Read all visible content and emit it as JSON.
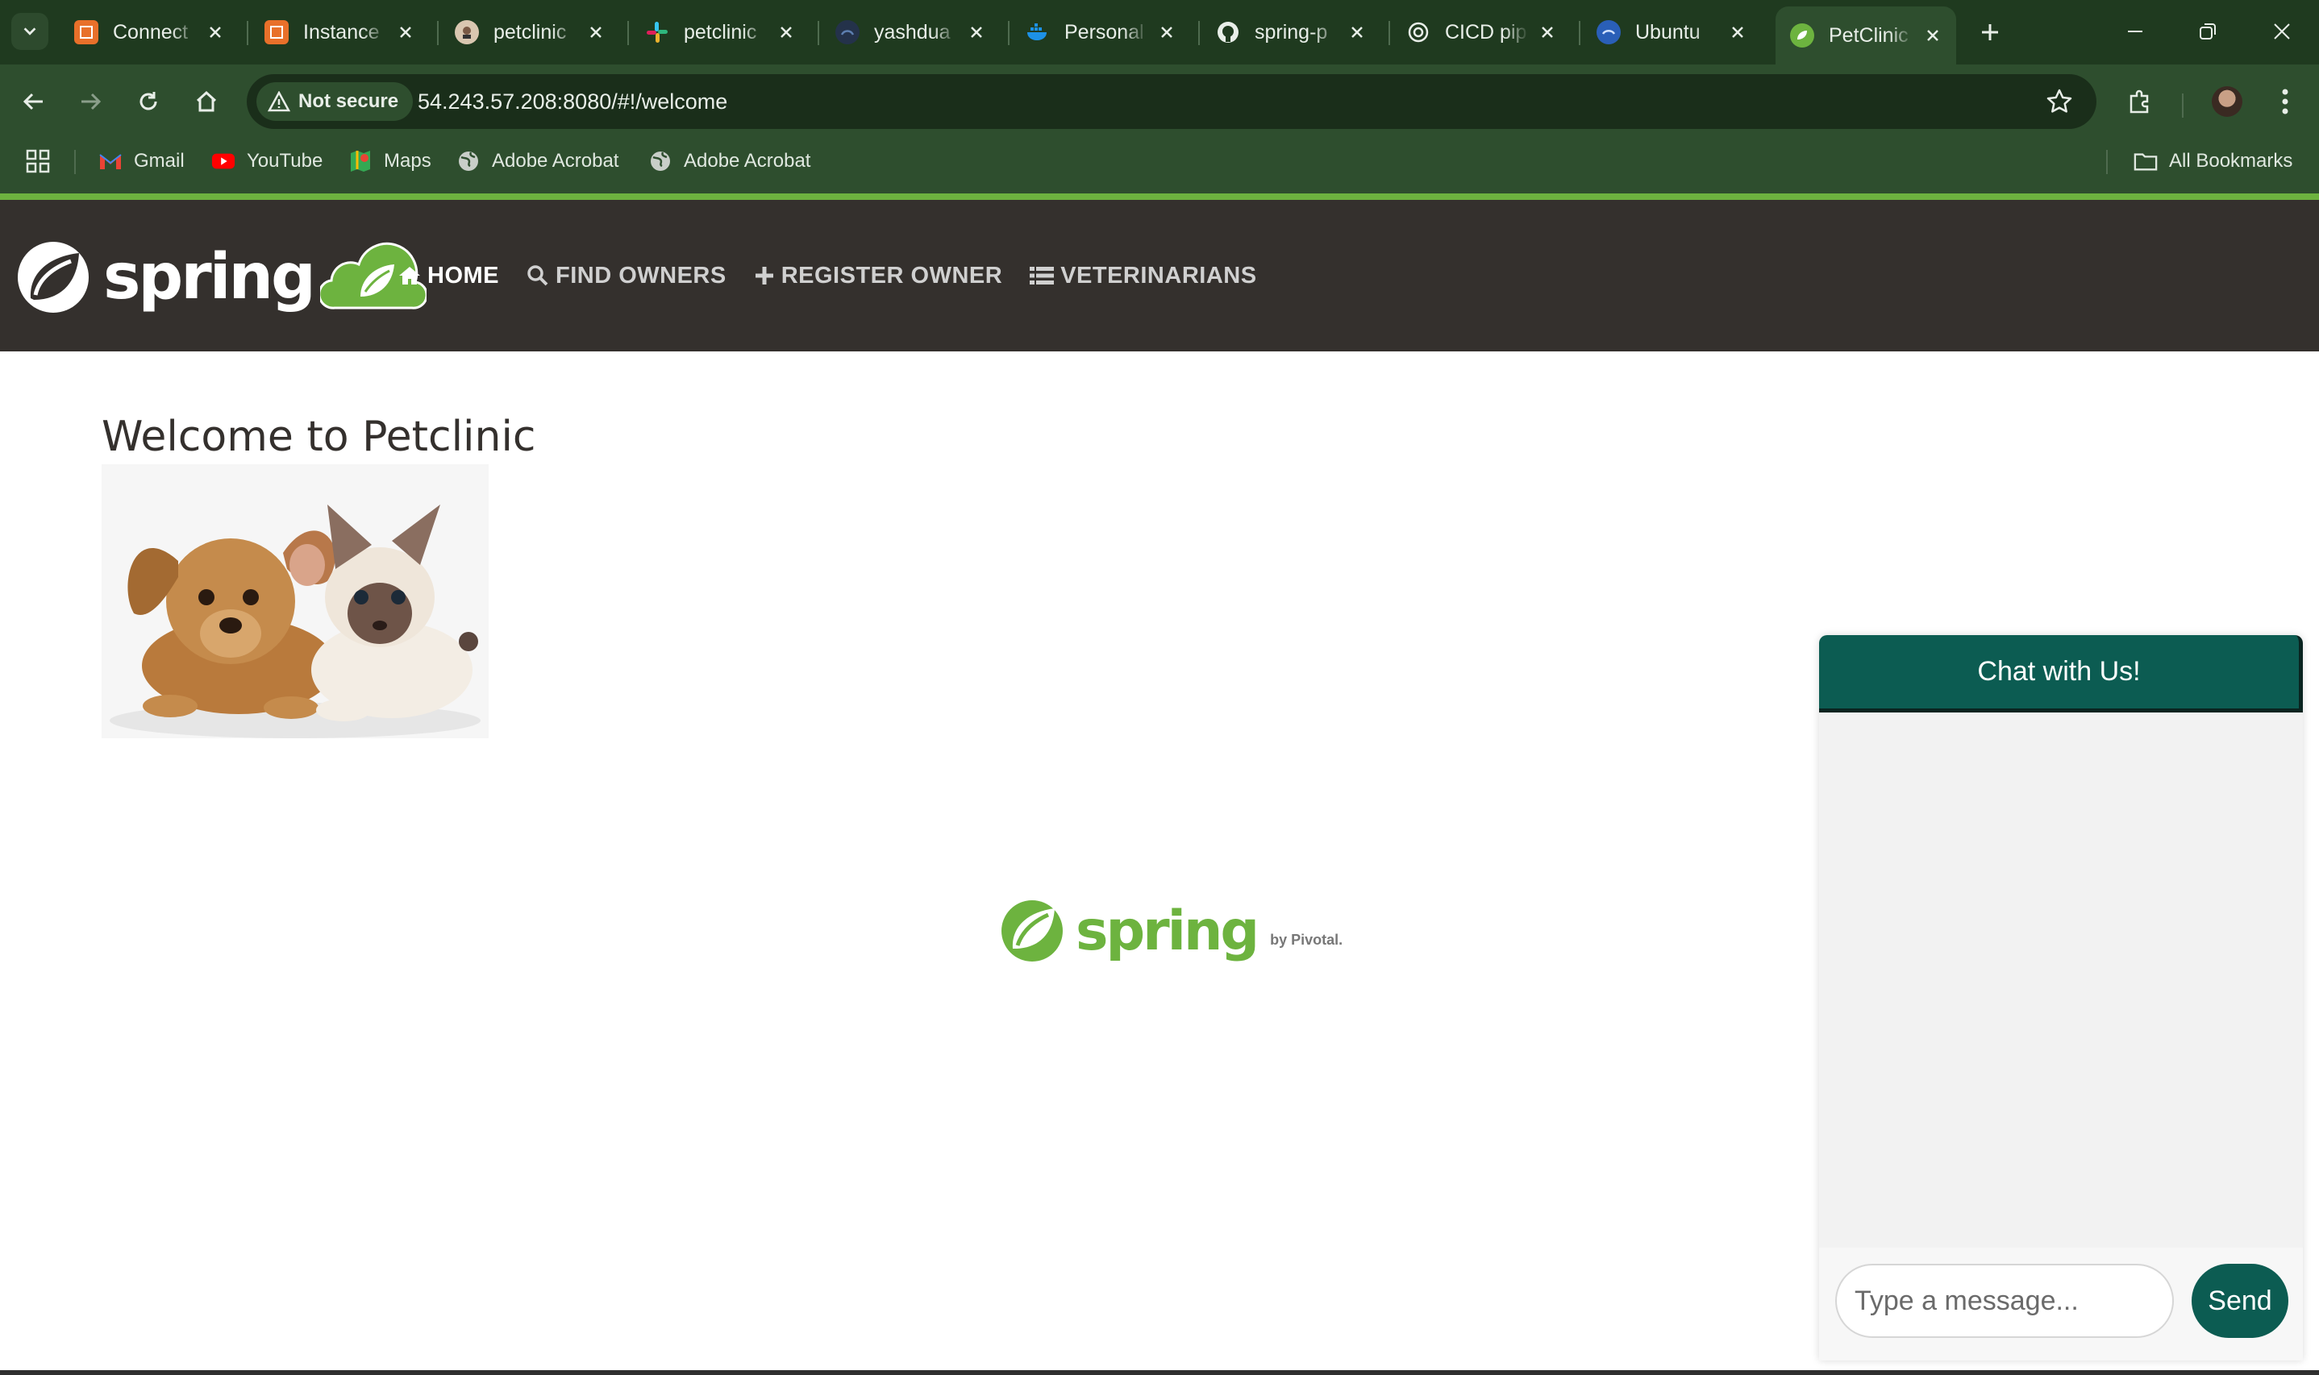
{
  "browser": {
    "tabs": [
      {
        "title": "Connect",
        "icon": "aws-icon",
        "active": false
      },
      {
        "title": "Instance",
        "icon": "aws-icon",
        "active": false
      },
      {
        "title": "petclinic",
        "icon": "jenkins-icon",
        "active": false
      },
      {
        "title": "petclinic",
        "icon": "slack-icon",
        "active": false
      },
      {
        "title": "yashdua",
        "icon": "github-avatar-icon",
        "active": false
      },
      {
        "title": "Personal",
        "icon": "docker-icon",
        "active": false
      },
      {
        "title": "spring-p",
        "icon": "github-icon",
        "active": false
      },
      {
        "title": "CICD pip",
        "icon": "chatgpt-icon",
        "active": false
      },
      {
        "title": "Ubuntu",
        "icon": "ubuntu-icon",
        "active": false
      },
      {
        "title": "PetClinic",
        "icon": "spring-icon",
        "active": true
      }
    ],
    "security_label": "Not secure",
    "url": "54.243.57.208:8080/#!/welcome",
    "bookmarks": [
      {
        "label": "Gmail",
        "icon": "gmail-icon"
      },
      {
        "label": "YouTube",
        "icon": "youtube-icon"
      },
      {
        "label": "Maps",
        "icon": "maps-icon"
      },
      {
        "label": "Adobe Acrobat",
        "icon": "globe-icon"
      },
      {
        "label": "Adobe Acrobat",
        "icon": "globe-icon"
      }
    ],
    "all_bookmarks_label": "All Bookmarks"
  },
  "app": {
    "logo_text": "spring",
    "nav": [
      {
        "label": "HOME",
        "icon": "home-icon"
      },
      {
        "label": "FIND OWNERS",
        "icon": "search-icon"
      },
      {
        "label": "REGISTER OWNER",
        "icon": "plus-icon"
      },
      {
        "label": "VETERINARIANS",
        "icon": "list-icon"
      }
    ],
    "welcome_title": "Welcome to Petclinic",
    "footer_logo_text": "spring",
    "footer_by": "by Pivotal."
  },
  "chat": {
    "title": "Chat with Us!",
    "placeholder": "Type a message...",
    "send_label": "Send"
  },
  "colors": {
    "chrome_dark": "#1f3a1f",
    "chrome": "#2e4e2e",
    "spring_green": "#6db33f",
    "nav_bg": "#34302d",
    "chat_teal": "#0c5c52"
  }
}
